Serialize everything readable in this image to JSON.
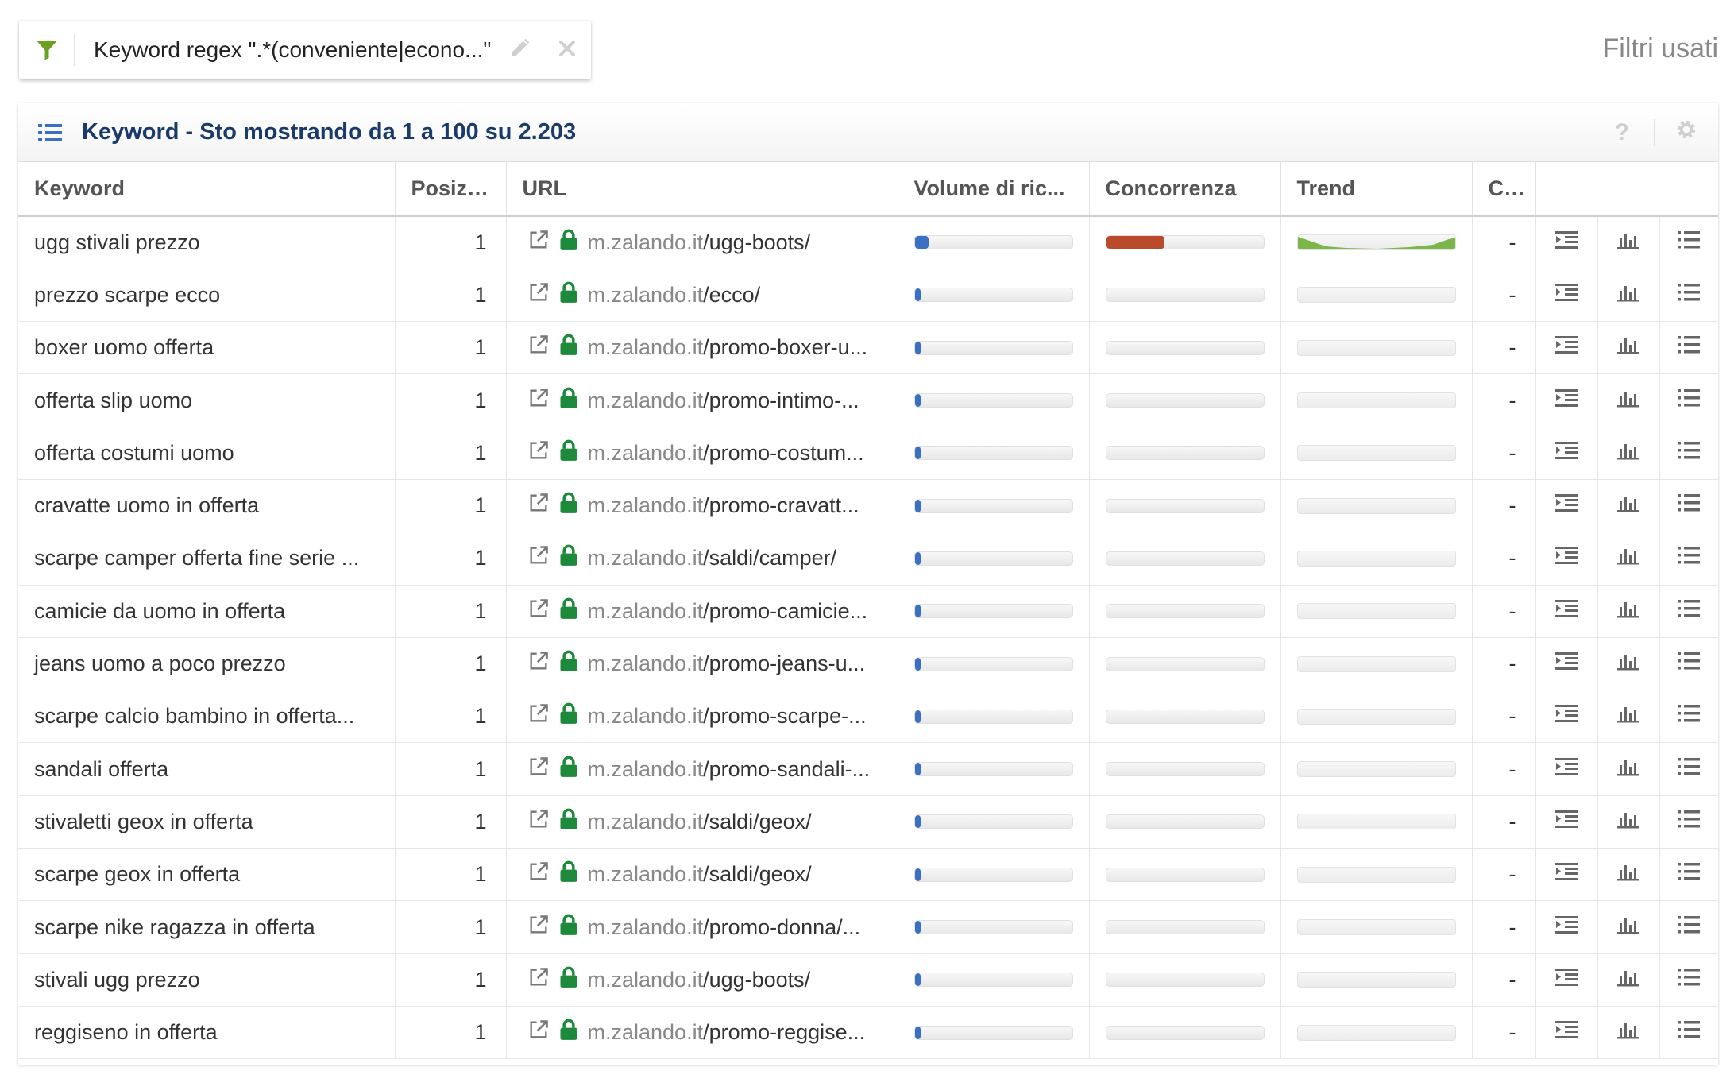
{
  "filter": {
    "label": "Keyword regex \".*(conveniente|econo...\"",
    "filter_icon": "funnel-icon",
    "edit_icon": "pencil-icon",
    "remove_icon": "close-icon"
  },
  "filters_used_label": "Filtri usati",
  "panel": {
    "title": "Keyword - Sto mostrando da 1 a 100 su 2.203",
    "help_label": "?",
    "settings_icon": "gear-icon"
  },
  "colors": {
    "volume_bar": "#3a6fc4",
    "competition_bar": "#b94a2c",
    "trend_line": "#7ab648",
    "filter_icon": "#6aa121",
    "lock_icon": "#1c8a3a",
    "title": "#1a3a6b"
  },
  "table": {
    "columns": [
      "Keyword",
      "Posizi...",
      "URL",
      "Volume di ric...",
      "Concorrenza",
      "Trend",
      "C..."
    ],
    "rows": [
      {
        "keyword": "ugg stivali prezzo",
        "position": "1",
        "domain": "m.zalando.it",
        "path": "/ugg-boots/",
        "volume": 0.09,
        "competition": 0.37,
        "has_trend": true,
        "c": "-"
      },
      {
        "keyword": "prezzo scarpe ecco",
        "position": "1",
        "domain": "m.zalando.it",
        "path": "/ecco/",
        "volume": 0.04,
        "competition": 0,
        "has_trend": false,
        "c": "-"
      },
      {
        "keyword": "boxer uomo offerta",
        "position": "1",
        "domain": "m.zalando.it",
        "path": "/promo-boxer-u...",
        "volume": 0.04,
        "competition": 0,
        "has_trend": false,
        "c": "-"
      },
      {
        "keyword": "offerta slip uomo",
        "position": "1",
        "domain": "m.zalando.it",
        "path": "/promo-intimo-...",
        "volume": 0.04,
        "competition": 0,
        "has_trend": false,
        "c": "-"
      },
      {
        "keyword": "offerta costumi uomo",
        "position": "1",
        "domain": "m.zalando.it",
        "path": "/promo-costum...",
        "volume": 0.04,
        "competition": 0,
        "has_trend": false,
        "c": "-"
      },
      {
        "keyword": "cravatte uomo in offerta",
        "position": "1",
        "domain": "m.zalando.it",
        "path": "/promo-cravatt...",
        "volume": 0.04,
        "competition": 0,
        "has_trend": false,
        "c": "-"
      },
      {
        "keyword": "scarpe camper offerta fine serie ...",
        "position": "1",
        "domain": "m.zalando.it",
        "path": "/saldi/camper/",
        "volume": 0.04,
        "competition": 0,
        "has_trend": false,
        "c": "-"
      },
      {
        "keyword": "camicie da uomo in offerta",
        "position": "1",
        "domain": "m.zalando.it",
        "path": "/promo-camicie...",
        "volume": 0.04,
        "competition": 0,
        "has_trend": false,
        "c": "-"
      },
      {
        "keyword": "jeans uomo a poco prezzo",
        "position": "1",
        "domain": "m.zalando.it",
        "path": "/promo-jeans-u...",
        "volume": 0.04,
        "competition": 0,
        "has_trend": false,
        "c": "-"
      },
      {
        "keyword": "scarpe calcio bambino in offerta...",
        "position": "1",
        "domain": "m.zalando.it",
        "path": "/promo-scarpe-...",
        "volume": 0.04,
        "competition": 0,
        "has_trend": false,
        "c": "-"
      },
      {
        "keyword": "sandali offerta",
        "position": "1",
        "domain": "m.zalando.it",
        "path": "/promo-sandali-...",
        "volume": 0.04,
        "competition": 0,
        "has_trend": false,
        "c": "-"
      },
      {
        "keyword": "stivaletti geox in offerta",
        "position": "1",
        "domain": "m.zalando.it",
        "path": "/saldi/geox/",
        "volume": 0.04,
        "competition": 0,
        "has_trend": false,
        "c": "-"
      },
      {
        "keyword": "scarpe geox in offerta",
        "position": "1",
        "domain": "m.zalando.it",
        "path": "/saldi/geox/",
        "volume": 0.04,
        "competition": 0,
        "has_trend": false,
        "c": "-"
      },
      {
        "keyword": "scarpe nike ragazza in offerta",
        "position": "1",
        "domain": "m.zalando.it",
        "path": "/promo-donna/...",
        "volume": 0.04,
        "competition": 0,
        "has_trend": false,
        "c": "-"
      },
      {
        "keyword": "stivali ugg prezzo",
        "position": "1",
        "domain": "m.zalando.it",
        "path": "/ugg-boots/",
        "volume": 0.04,
        "competition": 0,
        "has_trend": false,
        "c": "-"
      },
      {
        "keyword": "reggiseno in offerta",
        "position": "1",
        "domain": "m.zalando.it",
        "path": "/promo-reggise...",
        "volume": 0.04,
        "competition": 0,
        "has_trend": false,
        "c": "-"
      }
    ],
    "row_actions": [
      "indent-list-icon",
      "bar-chart-icon",
      "bullet-list-icon"
    ]
  }
}
